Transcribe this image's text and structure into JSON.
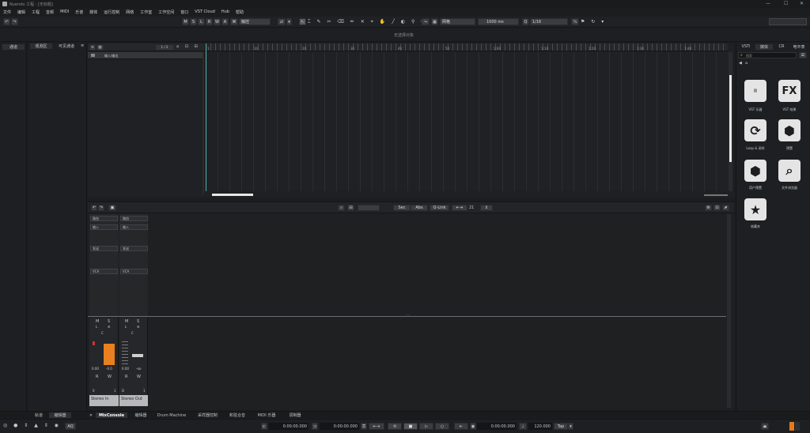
{
  "window": {
    "title": "Nuendo 工程 - [无标题]"
  },
  "menu": [
    "文件",
    "编辑",
    "工程",
    "音频",
    "MIDI",
    "乐谱",
    "媒体",
    "运行控制",
    "网络",
    "工作室",
    "工作空间",
    "窗口",
    "VST Cloud",
    "Hub",
    "帮助"
  ],
  "toolbar": {
    "modes": [
      "M",
      "S",
      "L",
      "R",
      "W",
      "A"
    ],
    "touch_mode": "触控",
    "grid": "网格",
    "length": "1000 ms",
    "quantize": "1/16",
    "frac": "¹⁄₄"
  },
  "status_line": "无选择对象",
  "left_zone": {
    "tabs": [
      "通道"
    ]
  },
  "inspector": {
    "tabs": [
      "观测区",
      "可见通道"
    ],
    "list_count": "1 / 2",
    "track_name": "输入/输出"
  },
  "ruler": {
    "marks": [
      "1",
      "10",
      "20",
      "30",
      "40",
      "50",
      "1:00",
      "1:10",
      "1:20",
      "1:30",
      "1:40"
    ]
  },
  "lower": {
    "sws_labels": [
      "Sec",
      "Abs",
      "Q-Link"
    ],
    "channel_count": "21",
    "routing": {
      "left": [
        "路由",
        "输入",
        "发送",
        "VCA"
      ],
      "right": [
        "路由",
        "输入",
        "发送",
        "VCA"
      ]
    },
    "strip_left": {
      "name": "Stereo In",
      "m": "M",
      "s": "S",
      "l": "L",
      "r": "R",
      "w": "W",
      "val1": "0.00",
      "val2": "-0.0",
      "pan": "C",
      "num": "1",
      "io": "0"
    },
    "strip_right": {
      "name": "Stereo Out",
      "m": "M",
      "s": "S",
      "l": "L",
      "r": "R",
      "w": "W",
      "val1": "0.00",
      "val2": "-oo",
      "pan": "C",
      "num": "1",
      "io": "D"
    }
  },
  "right_zone": {
    "tabs": [
      "VSTi",
      "媒体",
      "CR",
      "电平表"
    ],
    "search_placeholder": "搜索",
    "tiles": [
      {
        "glyph": "▥",
        "label": "VST 乐器"
      },
      {
        "glyph": "FX",
        "label": "VST 效果"
      },
      {
        "glyph": "⟳",
        "label": "Loop & 采样"
      },
      {
        "glyph": "⬢",
        "label": "预置"
      },
      {
        "glyph": "⬢",
        "label": "用户预置"
      },
      {
        "glyph": "⌕",
        "label": "文件浏览器"
      },
      {
        "glyph": "★",
        "label": "收藏夹"
      }
    ]
  },
  "bottom_tabs": {
    "left": [
      "轨道",
      "编辑器"
    ],
    "right": [
      "MixConsole",
      "编辑器",
      "Drum Machine",
      "采样器控制",
      "和弦合音",
      "MIDI 乐器",
      "调制器"
    ]
  },
  "transport": {
    "start_time": "0:00:00.000",
    "end_time": "0:00:00.000",
    "position": "0:00:00.000",
    "tempo": "120.000",
    "tap": "Tap",
    "aq": "AQ"
  },
  "colors": {
    "accent": "#e37b1c",
    "fader": "#e9801f",
    "meter_red": "#d03232",
    "cursor": "#56b2b2"
  }
}
